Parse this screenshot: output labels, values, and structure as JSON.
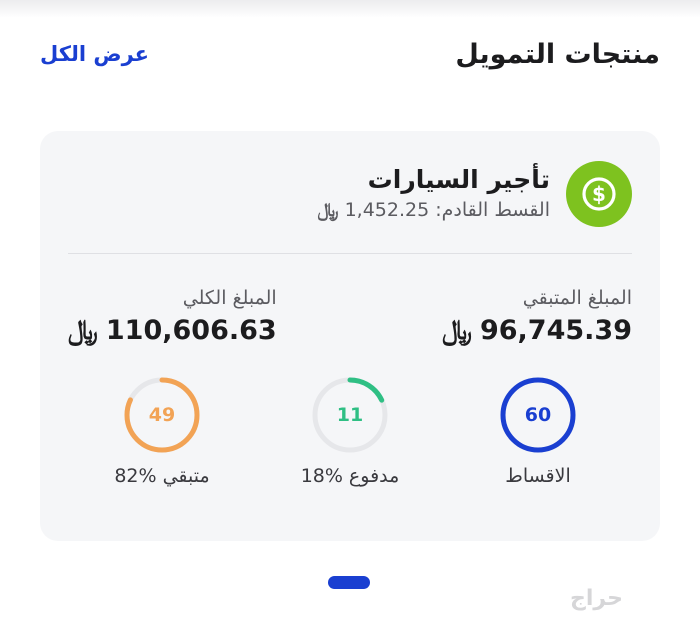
{
  "header": {
    "title": "منتجات التمويل",
    "view_all": "عرض الكل"
  },
  "product": {
    "name": "تأجير السيارات",
    "next_installment_label": "القسط القادم:",
    "next_installment_value": "1,452.25",
    "icon": "dollar-coin-icon",
    "icon_color": "#7ec21f"
  },
  "amounts": {
    "remaining_label": "المبلغ المتبقي",
    "remaining_value": "96,745.39",
    "total_label": "المبلغ الكلي",
    "total_value": "110,606.63"
  },
  "stats": [
    {
      "number": "60",
      "label": "الاقساط",
      "percent": "",
      "fraction": 1.0,
      "color": "#1a3fd1"
    },
    {
      "number": "11",
      "label": "مدفوع",
      "percent": "18%",
      "fraction": 0.18,
      "color": "#2fbf84"
    },
    {
      "number": "49",
      "label": "متبقي",
      "percent": "82%",
      "fraction": 0.82,
      "color": "#f2a355"
    }
  ],
  "currency_symbol": "﷼",
  "watermark": "حراج"
}
